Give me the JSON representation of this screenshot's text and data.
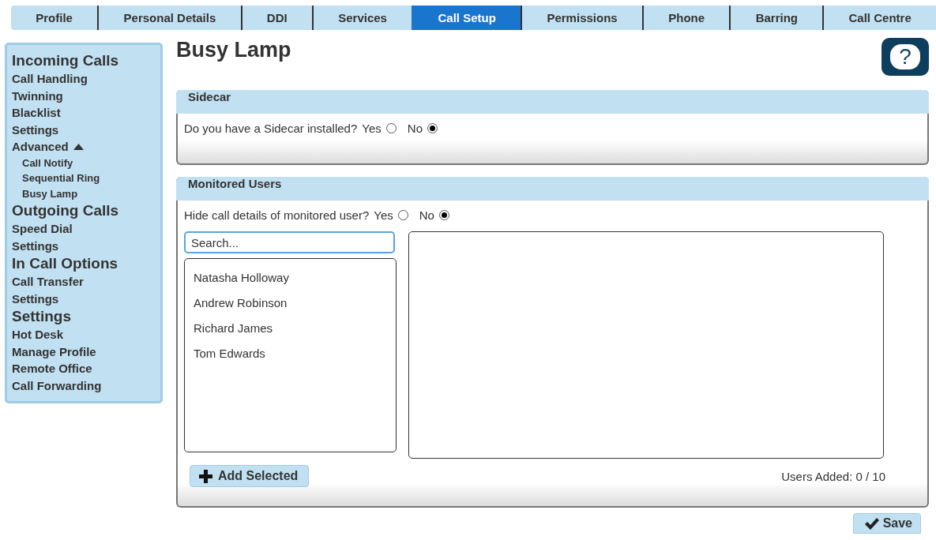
{
  "tabs": [
    {
      "label": "Profile",
      "selected": false
    },
    {
      "label": "Personal Details",
      "selected": false
    },
    {
      "label": "DDI",
      "selected": false
    },
    {
      "label": "Services",
      "selected": false
    },
    {
      "label": "Call Setup",
      "selected": true
    },
    {
      "label": "Permissions",
      "selected": false
    },
    {
      "label": "Phone",
      "selected": false
    },
    {
      "label": "Barring",
      "selected": false
    },
    {
      "label": "Call Centre",
      "selected": false
    }
  ],
  "sidebar": {
    "sections": [
      {
        "heading": "Incoming Calls",
        "items": [
          {
            "label": "Call Handling"
          },
          {
            "label": "Twinning"
          },
          {
            "label": "Blacklist"
          },
          {
            "label": "Settings"
          },
          {
            "label": "Advanced",
            "expanded": true,
            "children": [
              {
                "label": "Call Notify"
              },
              {
                "label": "Sequential Ring"
              },
              {
                "label": "Busy Lamp"
              }
            ]
          }
        ]
      },
      {
        "heading": "Outgoing Calls",
        "items": [
          {
            "label": "Speed Dial"
          },
          {
            "label": "Settings"
          }
        ]
      },
      {
        "heading": "In Call Options",
        "items": [
          {
            "label": "Call Transfer"
          },
          {
            "label": "Settings"
          }
        ]
      },
      {
        "heading": "Settings",
        "items": [
          {
            "label": "Hot Desk"
          },
          {
            "label": "Manage Profile"
          },
          {
            "label": "Remote Office"
          },
          {
            "label": "Call Forwarding"
          }
        ]
      }
    ]
  },
  "page_title": "Busy Lamp",
  "help": {
    "label": "?"
  },
  "sidecar": {
    "title": "Sidecar",
    "question": "Do you have a Sidecar installed?",
    "options": [
      {
        "label": "Yes",
        "selected": false
      },
      {
        "label": "No",
        "selected": true
      }
    ]
  },
  "monitored_users": {
    "title": "Monitored Users",
    "question": "Hide call details of monitored user?",
    "options": [
      {
        "label": "Yes",
        "selected": false
      },
      {
        "label": "No",
        "selected": true
      }
    ],
    "search": {
      "placeholder": "Search..."
    },
    "available_users": [
      "Natasha Holloway",
      "Andrew Robinson",
      "Richard James",
      "Tom Edwards"
    ],
    "add_button": "Add Selected",
    "users_added": "Users Added: 0 / 10"
  },
  "save_button": "Save"
}
